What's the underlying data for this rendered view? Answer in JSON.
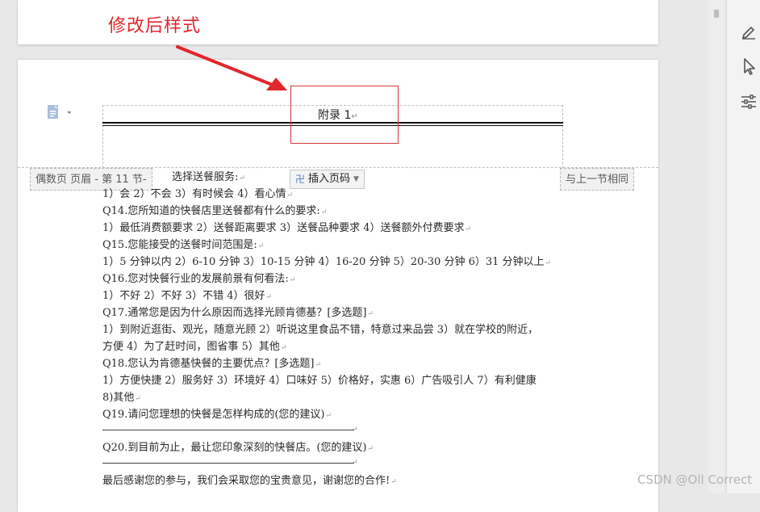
{
  "annotation": {
    "text": "修改后样式"
  },
  "header": {
    "title": "附录 1",
    "left_label": "偶数页 页眉  - 第 11 节-",
    "insert_page_number": "插入页码",
    "same_as_previous": "与上一节相同"
  },
  "body": {
    "lines": [
      "选择送餐服务:",
      "1）会 2）不会 3）有时候会 4）看心情",
      "Q14.您所知道的快餐店里送餐都有什么的要求:",
      "1）最低消费额要求 2）送餐距离要求 3）送餐品种要求 4）送餐额外付费要求",
      "Q15.您能接受的送餐时间范围是:",
      "1）5 分钟以内 2）6-10 分钟 3）10-15 分钟 4）16-20 分钟 5）20-30 分钟 6）31 分钟以上",
      "Q16.您对快餐行业的发展前景有何看法:",
      "1）不好 2）不好 3）不错 4）很好",
      "Q17.通常您是因为什么原因而选择光顾肯德基？[多选题]",
      "1）到附近逛街、观光，随意光顾 2）听说这里食品不错，特意过来品尝 3）就在学校的附近，",
      "方便 4）为了赶时间，图省事 5）其他",
      "Q18.您认为肯德基快餐的主要优点？[多选题]",
      "1）方便快捷 2）服务好 3）环境好 4）口味好 5）价格好，实惠 6）广告吸引人 7）有利健康",
      "8)其他",
      "Q19.请问您理想的快餐是怎样构成的(您的建议)",
      "",
      "Q20.到目前为止，最让您印象深刻的快餐店。(您的建议)",
      "",
      "最后感谢您的参与，我们会采取您的宝贵意见，谢谢您的合作!"
    ]
  },
  "watermark": {
    "text": "CSDN @Oll Correct"
  },
  "colors": {
    "annotation": "#e0262b",
    "accent": "#4a7bd0"
  },
  "rail_icons": [
    "pen-icon",
    "cursor-icon",
    "sliders-icon"
  ]
}
